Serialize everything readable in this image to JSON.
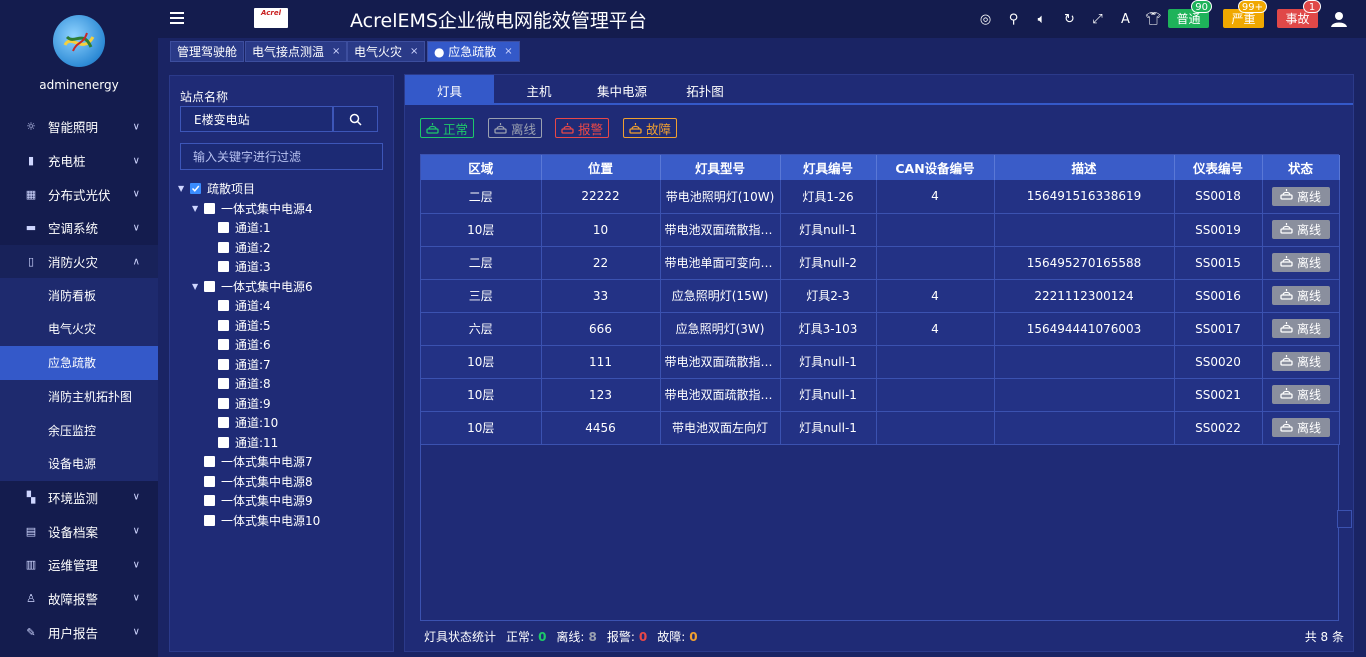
{
  "user": {
    "name": "adminenergy"
  },
  "menu": [
    {
      "label": "智能照明",
      "icon": "bulb-icon"
    },
    {
      "label": "充电桩",
      "icon": "charger-icon"
    },
    {
      "label": "分布式光伏",
      "icon": "solar-icon"
    },
    {
      "label": "空调系统",
      "icon": "aircon-icon"
    },
    {
      "label": "消防火灾",
      "icon": "extinguisher-icon"
    },
    {
      "label": "环境监测",
      "icon": "environment-icon"
    },
    {
      "label": "设备档案",
      "icon": "archive-icon"
    },
    {
      "label": "运维管理",
      "icon": "maintenance-icon"
    },
    {
      "label": "故障报警",
      "icon": "alarm-icon"
    },
    {
      "label": "用户报告",
      "icon": "report-icon"
    }
  ],
  "submenu": [
    "消防看板",
    "电气火灾",
    "应急疏散",
    "消防主机拓扑图",
    "余压监控",
    "设备电源"
  ],
  "header": {
    "logo_text": "Acrel",
    "title": "AcrelEMS企业微电网能效管理平台",
    "alarms": [
      {
        "label": "普通",
        "count": "90",
        "color": "#1eb35a"
      },
      {
        "label": "严重",
        "count": "99+",
        "color": "#f0a800"
      },
      {
        "label": "事故",
        "count": "1",
        "color": "#e04848"
      }
    ]
  },
  "tabs": [
    {
      "label": "管理驾驶舱",
      "closable": false
    },
    {
      "label": "电气接点测温",
      "closable": true
    },
    {
      "label": "电气火灾",
      "closable": true
    },
    {
      "label": "● 应急疏散",
      "closable": true
    }
  ],
  "tree_panel": {
    "station_label": "站点名称",
    "station_value": "E楼变电站",
    "filter_placeholder": "输入关键字进行过滤",
    "nodes": [
      {
        "label": "疏散项目",
        "level": 0,
        "expand": "down",
        "checked": true
      },
      {
        "label": "一体式集中电源4",
        "level": 1,
        "expand": "down",
        "checked": false
      },
      {
        "label": "通道:1",
        "level": 2,
        "expand": "",
        "checked": false
      },
      {
        "label": "通道:2",
        "level": 2,
        "expand": "",
        "checked": false
      },
      {
        "label": "通道:3",
        "level": 2,
        "expand": "",
        "checked": false
      },
      {
        "label": "一体式集中电源6",
        "level": 1,
        "expand": "down",
        "checked": false
      },
      {
        "label": "通道:4",
        "level": 2,
        "expand": "",
        "checked": false
      },
      {
        "label": "通道:5",
        "level": 2,
        "expand": "",
        "checked": false
      },
      {
        "label": "通道:6",
        "level": 2,
        "expand": "",
        "checked": false
      },
      {
        "label": "通道:7",
        "level": 2,
        "expand": "",
        "checked": false
      },
      {
        "label": "通道:8",
        "level": 2,
        "expand": "",
        "checked": false
      },
      {
        "label": "通道:9",
        "level": 2,
        "expand": "",
        "checked": false
      },
      {
        "label": "通道:10",
        "level": 2,
        "expand": "",
        "checked": false
      },
      {
        "label": "通道:11",
        "level": 2,
        "expand": "",
        "checked": false
      },
      {
        "label": "一体式集中电源7",
        "level": 1,
        "expand": "",
        "checked": false
      },
      {
        "label": "一体式集中电源8",
        "level": 1,
        "expand": "",
        "checked": false
      },
      {
        "label": "一体式集中电源9",
        "level": 1,
        "expand": "",
        "checked": false
      },
      {
        "label": "一体式集中电源10",
        "level": 1,
        "expand": "",
        "checked": false
      }
    ]
  },
  "main_tabs": [
    "灯具",
    "主机",
    "集中电源",
    "拓扑图"
  ],
  "legend": [
    {
      "label": "正常",
      "color": "#1ec86a"
    },
    {
      "label": "离线",
      "color": "#9aa0b0"
    },
    {
      "label": "报警",
      "color": "#e84848"
    },
    {
      "label": "故障",
      "color": "#f0a030"
    }
  ],
  "table": {
    "columns": [
      "区域",
      "位置",
      "灯具型号",
      "灯具编号",
      "CAN设备编号",
      "描述",
      "仪表编号",
      "状态"
    ],
    "rows": [
      [
        "二层",
        "22222",
        "带电池照明灯(10W)",
        "灯具1-26",
        "4",
        "156491516338619",
        "SS0018",
        "离线"
      ],
      [
        "10层",
        "10",
        "带电池双面疏散指示灯",
        "灯具null-1",
        "",
        "",
        "SS0019",
        "离线"
      ],
      [
        "二层",
        "22",
        "带电池单面可变向指示灯",
        "灯具null-2",
        "",
        "156495270165588",
        "SS0015",
        "离线"
      ],
      [
        "三层",
        "33",
        "应急照明灯(15W)",
        "灯具2-3",
        "4",
        "2221112300124",
        "SS0016",
        "离线"
      ],
      [
        "六层",
        "666",
        "应急照明灯(3W)",
        "灯具3-103",
        "4",
        "156494441076003",
        "SS0017",
        "离线"
      ],
      [
        "10层",
        "111",
        "带电池双面疏散指示灯",
        "灯具null-1",
        "",
        "",
        "SS0020",
        "离线"
      ],
      [
        "10层",
        "123",
        "带电池双面疏散指示灯",
        "灯具null-1",
        "",
        "",
        "SS0021",
        "离线"
      ],
      [
        "10层",
        "4456",
        "带电池双面左向灯",
        "灯具null-1",
        "",
        "",
        "SS0022",
        "离线"
      ]
    ]
  },
  "footer": {
    "label": "灯具状态统计",
    "stats": [
      {
        "label": "正常:",
        "value": "0",
        "color": "#1ec86a"
      },
      {
        "label": "离线:",
        "value": "8",
        "color": "#9aa0b0"
      },
      {
        "label": "报警:",
        "value": "0",
        "color": "#e84848"
      },
      {
        "label": "故障:",
        "value": "0",
        "color": "#f0a030"
      }
    ],
    "total": "共 8 条"
  }
}
